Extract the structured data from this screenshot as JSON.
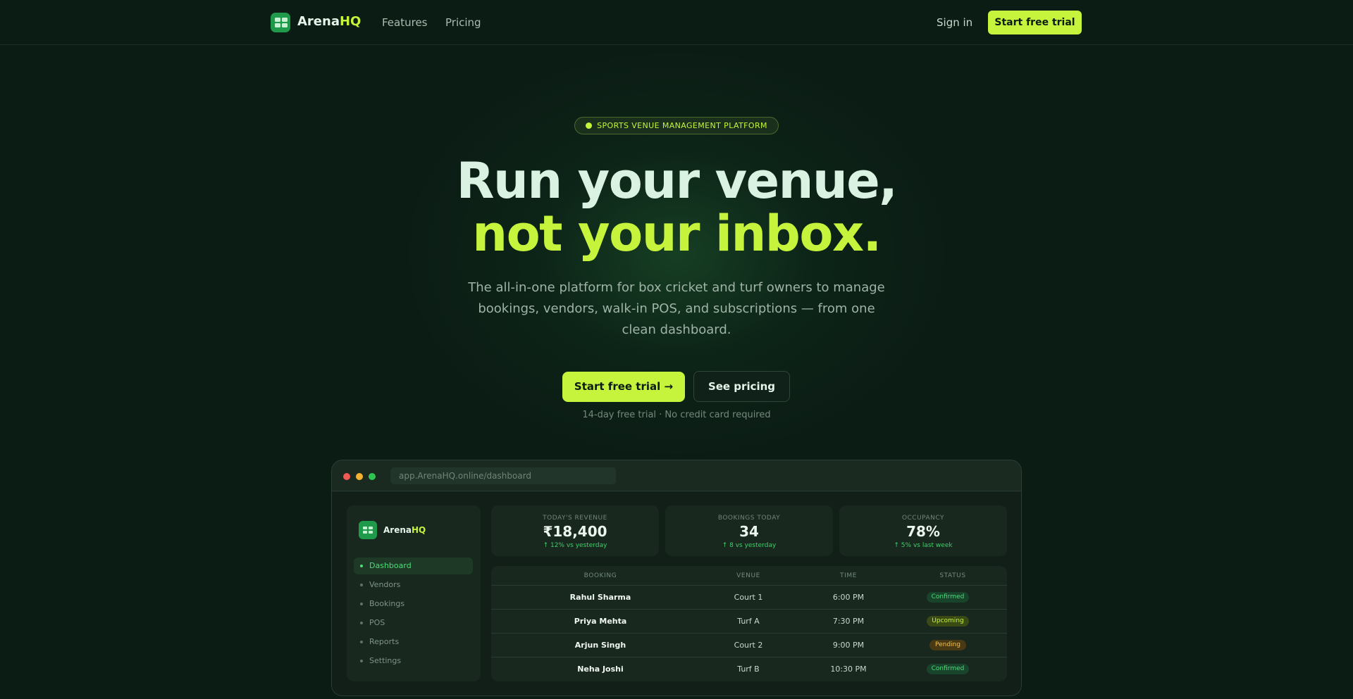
{
  "nav": {
    "brand_prefix": "Arena",
    "brand_suffix": "HQ",
    "links": [
      "Features",
      "Pricing"
    ],
    "sign_in": "Sign in",
    "cta": "Start free trial"
  },
  "hero": {
    "badge": "SPORTS VENUE MANAGEMENT PLATFORM",
    "title_line1": "Run your venue,",
    "title_line2": "not your inbox.",
    "subtitle": "The all-in-one platform for box cricket and turf owners to manage bookings, vendors, walk-in POS, and subscriptions — from one clean dashboard.",
    "primary_cta": "Start free trial →",
    "secondary_cta": "See pricing",
    "note": "14-day free trial · No credit card required"
  },
  "preview": {
    "url": "app.ArenaHQ.online/dashboard",
    "brand_prefix": "Arena",
    "brand_suffix": "HQ",
    "sidebar": [
      "Dashboard",
      "Vendors",
      "Bookings",
      "POS",
      "Reports",
      "Settings"
    ],
    "active_item": "Dashboard",
    "stats": [
      {
        "label": "TODAY'S REVENUE",
        "value": "₹18,400",
        "change": "↑ 12% vs yesterday"
      },
      {
        "label": "BOOKINGS TODAY",
        "value": "34",
        "change": "↑ 8 vs yesterday"
      },
      {
        "label": "OCCUPANCY",
        "value": "78%",
        "change": "↑ 5% vs last week"
      }
    ],
    "table": {
      "headers": [
        "BOOKING",
        "VENUE",
        "TIME",
        "STATUS"
      ],
      "rows": [
        {
          "name": "Rahul Sharma",
          "venue": "Court 1",
          "time": "6:00 PM",
          "status": "Confirmed",
          "tone": "confirmed"
        },
        {
          "name": "Priya Mehta",
          "venue": "Turf A",
          "time": "7:30 PM",
          "status": "Upcoming",
          "tone": "upcoming"
        },
        {
          "name": "Arjun Singh",
          "venue": "Court 2",
          "time": "9:00 PM",
          "status": "Pending",
          "tone": "pending"
        },
        {
          "name": "Neha Joshi",
          "venue": "Turf B",
          "time": "10:30 PM",
          "status": "Confirmed",
          "tone": "confirmed"
        }
      ]
    }
  },
  "colors": {
    "background": "#0b1c14",
    "accent": "#c6f43c",
    "brand_green": "#1f9a4a",
    "positive": "#4fdc7a",
    "pending": "#f0c050"
  }
}
